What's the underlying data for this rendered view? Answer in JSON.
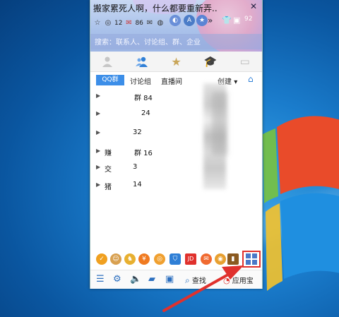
{
  "header": {
    "status_title": "搬家累死人啊，什么都要重新弄..",
    "stats": {
      "views": "12",
      "messages": "86",
      "level": "92"
    },
    "win_close": "✕"
  },
  "search": {
    "placeholder": "搜索：联系人、讨论组、群、企业"
  },
  "subtabs": {
    "qq_group": "QQ群",
    "discussion": "讨论组",
    "live": "直播间",
    "create": "创建",
    "create_caret": "▾",
    "home_icon": "⌂"
  },
  "groups": [
    {
      "label": "",
      "count": "群 84"
    },
    {
      "label": "",
      "count": "24"
    },
    {
      "label": "",
      "count": "32"
    },
    {
      "label": "赚",
      "count": "群 16"
    },
    {
      "label": "交",
      "count": "3"
    },
    {
      "label": "猪",
      "count": "14"
    }
  ],
  "bottombar": {
    "find_label": "查找",
    "appstore_label": "应用宝"
  },
  "colors": {
    "accent": "#3c8ee8",
    "highlight_box": "#e0312d",
    "annotation_arrow": "#e0312d"
  }
}
